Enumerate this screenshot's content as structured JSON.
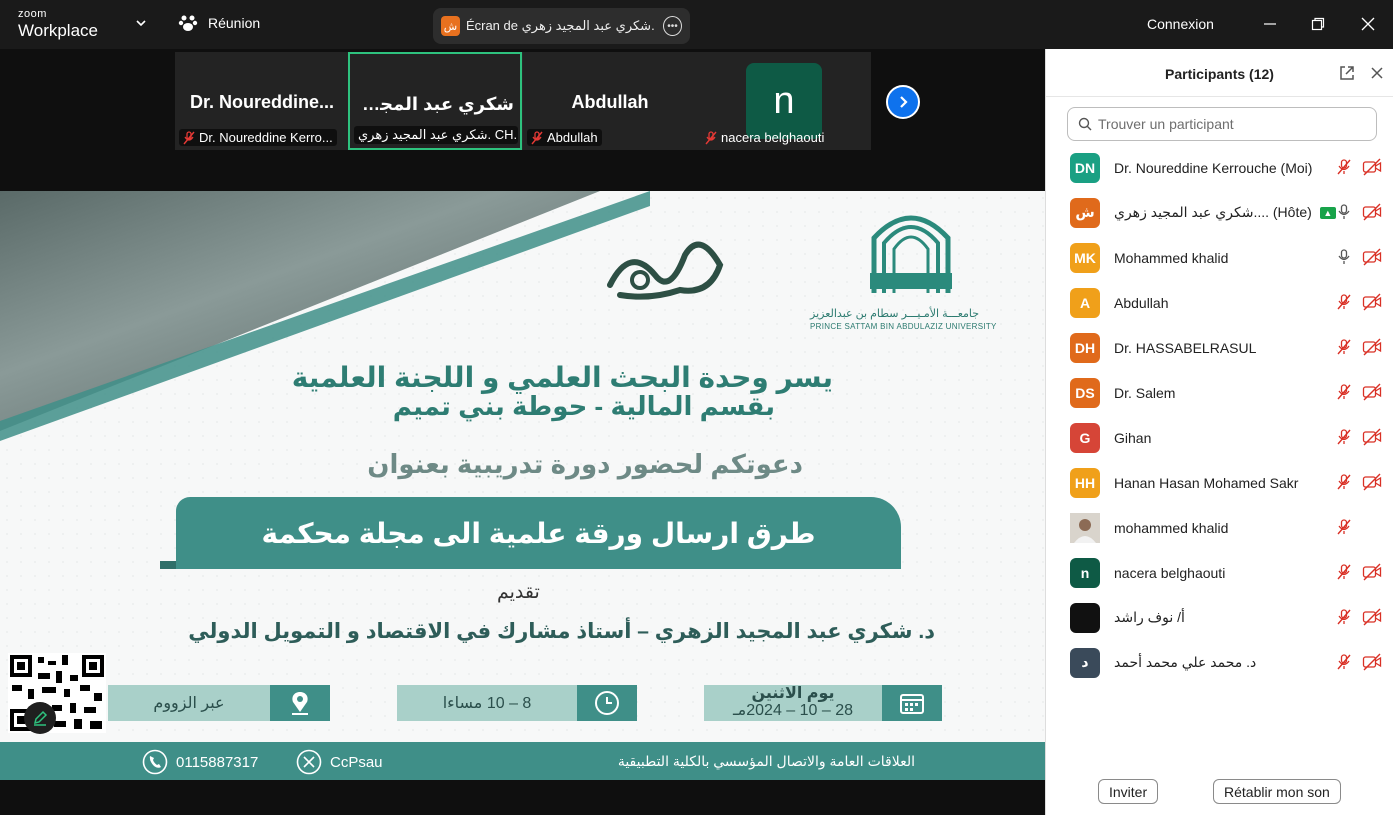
{
  "titlebar": {
    "brand_small": "zoom",
    "brand_big": "Workplace",
    "meeting_label": "Réunion",
    "share_label": "Écran de شكري عبد المجيد زهري. C",
    "share_avatar": "ش",
    "signin_label": "Connexion"
  },
  "gallery": {
    "tiles": [
      {
        "big_name": "Dr.  Noureddine...",
        "label": "Dr. Noureddine Kerro..."
      },
      {
        "big_name": "شكري عبد المجيد...",
        "label": "شكري عبد المجيد زهري. CH..."
      },
      {
        "big_name": "Abdullah",
        "label": "Abdullah"
      },
      {
        "avatar_letter": "n",
        "label": "nacera belghaouti"
      }
    ]
  },
  "poster": {
    "univ_ar": "جامعـــة الأمـيـــر سطام بن عبدالعزيز",
    "univ_en": "PRINCE SATTAM BIN ABDULAZIZ UNIVERSITY",
    "line1": "يسر وحدة البحث العلمي و اللجنة العلمية",
    "line2": "بقسم المالية   - حوطة بني تميم",
    "line3": "دعوتكم لحضور دورة تدريبية بعنوان",
    "title": "طرق ارسال ورقة علمية الى مجلة محكمة",
    "presented_by": "تقديم",
    "presenter": "د. شكري عبد المجيد الزهري – أستاذ مشارك في الاقتصاد و التمويل الدولي",
    "info_place": "عبر الزووم",
    "info_time": "8 – 10 مساءا",
    "info_day": "يوم الاثنين",
    "info_date": "28 – 10 – 2024مـ",
    "footer_right": "العلاقات العامة والاتصال المؤسسي بالكلية التطبيقية",
    "footer_phone": "0115887317",
    "footer_handle": "CcPsau"
  },
  "panel": {
    "title": "Participants (12)",
    "search_placeholder": "Trouver un participant",
    "participants": [
      {
        "initials": "DN",
        "color": "#1aa083",
        "name": "Dr. Noureddine Kerrouche (Moi)",
        "mic": "muted",
        "video": "off"
      },
      {
        "initials": "ش",
        "color": "#e06a1b",
        "name": "شكري عبد المجيد زهري.... (Hôte)",
        "mic": "on",
        "video": "off",
        "host": true
      },
      {
        "initials": "MK",
        "color": "#f0a01a",
        "name": "Mohammed khalid",
        "mic": "on",
        "video": "off"
      },
      {
        "initials": "A",
        "color": "#f0a01a",
        "name": "Abdullah",
        "mic": "muted",
        "video": "off"
      },
      {
        "initials": "DH",
        "color": "#e06a1b",
        "name": "Dr. HASSABELRASUL",
        "mic": "muted",
        "video": "off"
      },
      {
        "initials": "DS",
        "color": "#e06a1b",
        "name": "Dr. Salem",
        "mic": "muted",
        "video": "off"
      },
      {
        "initials": "G",
        "color": "#d64537",
        "name": "Gihan",
        "mic": "muted",
        "video": "off"
      },
      {
        "initials": "HH",
        "color": "#f0a01a",
        "name": "Hanan Hasan Mohamed Sakr",
        "mic": "muted",
        "video": "off"
      },
      {
        "initials": "",
        "color": "#8c7a6a",
        "name": "mohammed khalid",
        "mic": "muted",
        "video": "none",
        "photo": true
      },
      {
        "initials": "n",
        "color": "#0e5a45",
        "name": "nacera belghaouti",
        "mic": "muted",
        "video": "off"
      },
      {
        "initials": "",
        "color": "#111111",
        "name": "أ/ نوف راشد",
        "mic": "muted",
        "video": "off"
      },
      {
        "initials": "د",
        "color": "#3a4a5a",
        "name": "د. محمد علي محمد أحمد",
        "mic": "muted",
        "video": "off"
      }
    ],
    "invite_label": "Inviter",
    "unmute_label": "Rétablir mon son"
  },
  "colors": {
    "accent": "#0e72ed",
    "active_speaker": "#2ec27e",
    "muted_red": "#d93025",
    "poster_teal": "#3f8f88"
  }
}
